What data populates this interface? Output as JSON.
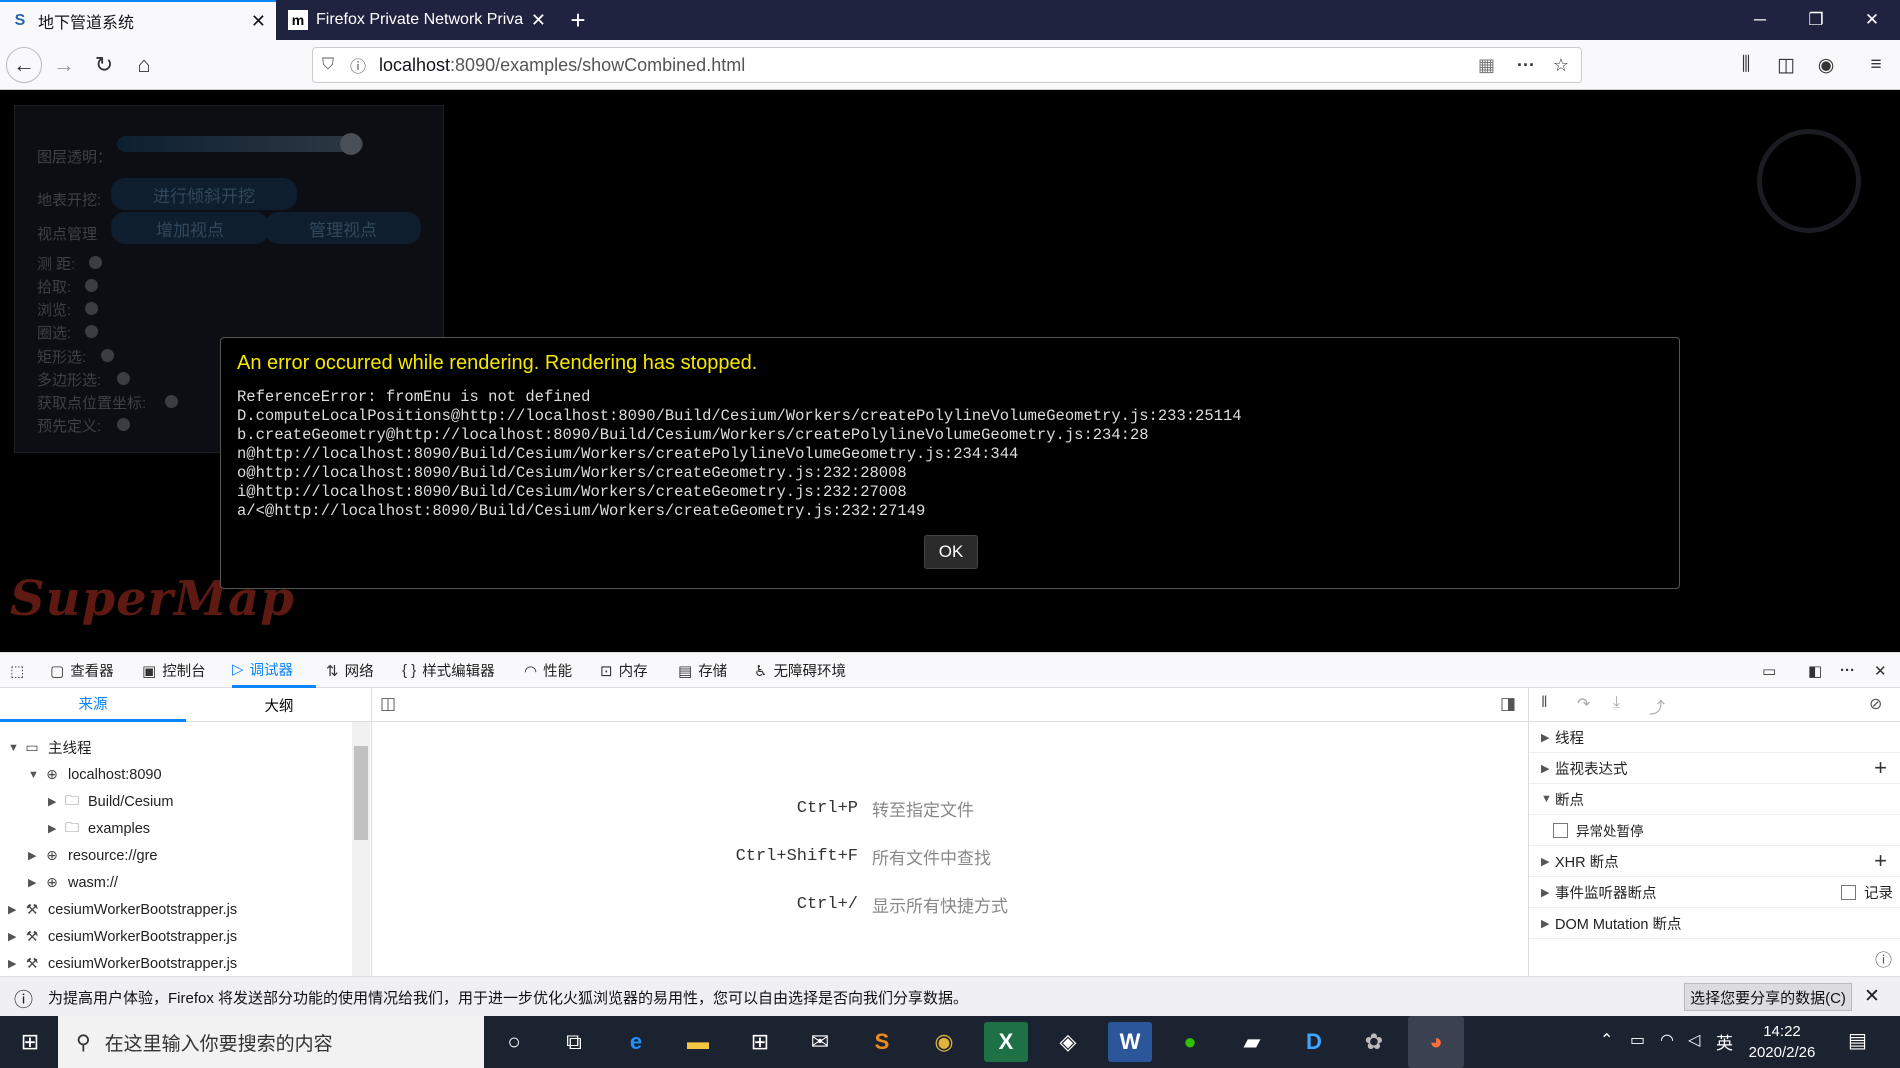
{
  "browser": {
    "tabs": [
      {
        "title": "地下管道系统",
        "favicon": "S"
      },
      {
        "title": "Firefox Private Network Priva",
        "favicon": "m"
      }
    ],
    "url_host": "localhost",
    "url_path": ":8090/examples/showCombined.html"
  },
  "panel": {
    "opacity_label": "图层透明：",
    "opacity_value": 0.95,
    "excavation_label": "地表开挖:",
    "excavation_button": "进行倾斜开挖",
    "viewpoint_label": "视点管理",
    "add_viewpoint": "增加视点",
    "manage_viewpoint": "管理视点",
    "options": [
      "测 距:",
      "拾取:",
      "浏览:",
      "圈选:",
      "矩形选:",
      "多边形选:",
      "获取点位置坐标:",
      "预先定义:"
    ]
  },
  "logo_text": "SuperMap",
  "error_dialog": {
    "title": "An error occurred while rendering. Rendering has stopped.",
    "message": "ReferenceError: fromEnu is not defined\nD.computeLocalPositions@http://localhost:8090/Build/Cesium/Workers/createPolylineVolumeGeometry.js:233:25114\nb.createGeometry@http://localhost:8090/Build/Cesium/Workers/createPolylineVolumeGeometry.js:234:28\nn@http://localhost:8090/Build/Cesium/Workers/createPolylineVolumeGeometry.js:234:344\no@http://localhost:8090/Build/Cesium/Workers/createGeometry.js:232:28008\ni@http://localhost:8090/Build/Cesium/Workers/createGeometry.js:232:27008\na/<@http://localhost:8090/Build/Cesium/Workers/createGeometry.js:232:27149",
    "ok_label": "OK"
  },
  "devtools": {
    "tools": [
      "查看器",
      "控制台",
      "调试器",
      "网络",
      "样式编辑器",
      "性能",
      "内存",
      "存储",
      "无障碍环境"
    ],
    "selected_tool": "调试器",
    "left_tabs": [
      "来源",
      "大纲"
    ],
    "tree": [
      {
        "label": "主线程"
      },
      {
        "label": "localhost:8090"
      },
      {
        "label": "Build/Cesium"
      },
      {
        "label": "examples"
      },
      {
        "label": "resource://gre"
      },
      {
        "label": "wasm://"
      },
      {
        "label": "cesiumWorkerBootstrapper.js"
      },
      {
        "label": "cesiumWorkerBootstrapper.js"
      },
      {
        "label": "cesiumWorkerBootstrapper.js"
      }
    ],
    "shortcuts": [
      {
        "key": "Ctrl+P",
        "desc": "转至指定文件"
      },
      {
        "key": "Ctrl+Shift+F",
        "desc": "所有文件中查找"
      },
      {
        "key": "Ctrl+/",
        "desc": "显示所有快捷方式"
      }
    ],
    "right_sections": {
      "threads": "线程",
      "watch": "监视表达式",
      "breakpoints": "断点",
      "pause_on_exceptions": "异常处暂停",
      "xhr": "XHR 断点",
      "event_listeners": "事件监听器断点",
      "record": "记录",
      "dom_mutation": "DOM Mutation 断点"
    }
  },
  "notification": {
    "text": "为提高用户体验，Firefox 将发送部分功能的使用情况给我们，用于进一步优化火狐浏览器的易用性，您可以自由选择是否向我们分享数据。",
    "button": "选择您要分享的数据(C)"
  },
  "taskbar": {
    "search_placeholder": "在这里输入你要搜索的内容",
    "ime": "英",
    "time": "14:22",
    "date": "2020/2/26"
  }
}
